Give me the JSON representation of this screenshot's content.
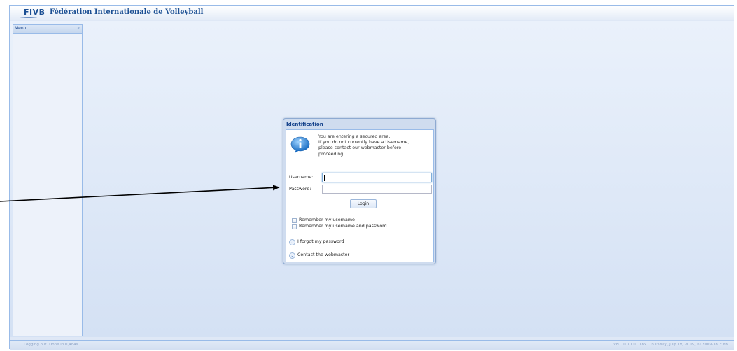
{
  "header": {
    "logo_text": "FIVB",
    "title": "Fédération Internationale de Volleyball"
  },
  "menu": {
    "title": "Menu",
    "collapse_glyph": "«"
  },
  "login": {
    "window_title": "Identification",
    "info_icon": "info-icon",
    "info_lines": [
      "You are entering a secured area.",
      "If you do not currently have a Username,",
      "please contact our webmaster before",
      "proceeding."
    ],
    "username_label": "Username:",
    "username_value": "",
    "password_label": "Password:",
    "password_value": "",
    "login_button": "Login",
    "remember_username": "Remember my username",
    "remember_username_password": "Remember my username and password",
    "forgot_password": "I forgot my password",
    "contact_webmaster": "Contact the webmaster"
  },
  "status": {
    "left": "Logging out. Done in 0,484s",
    "right": "VIS 10.7.10.1385, Thursday, July 18, 2019, © 2009-18 FIVB"
  },
  "colors": {
    "brand": "#1b4f93",
    "panel_border": "#99bbe8",
    "background": "#dfe8f6"
  }
}
